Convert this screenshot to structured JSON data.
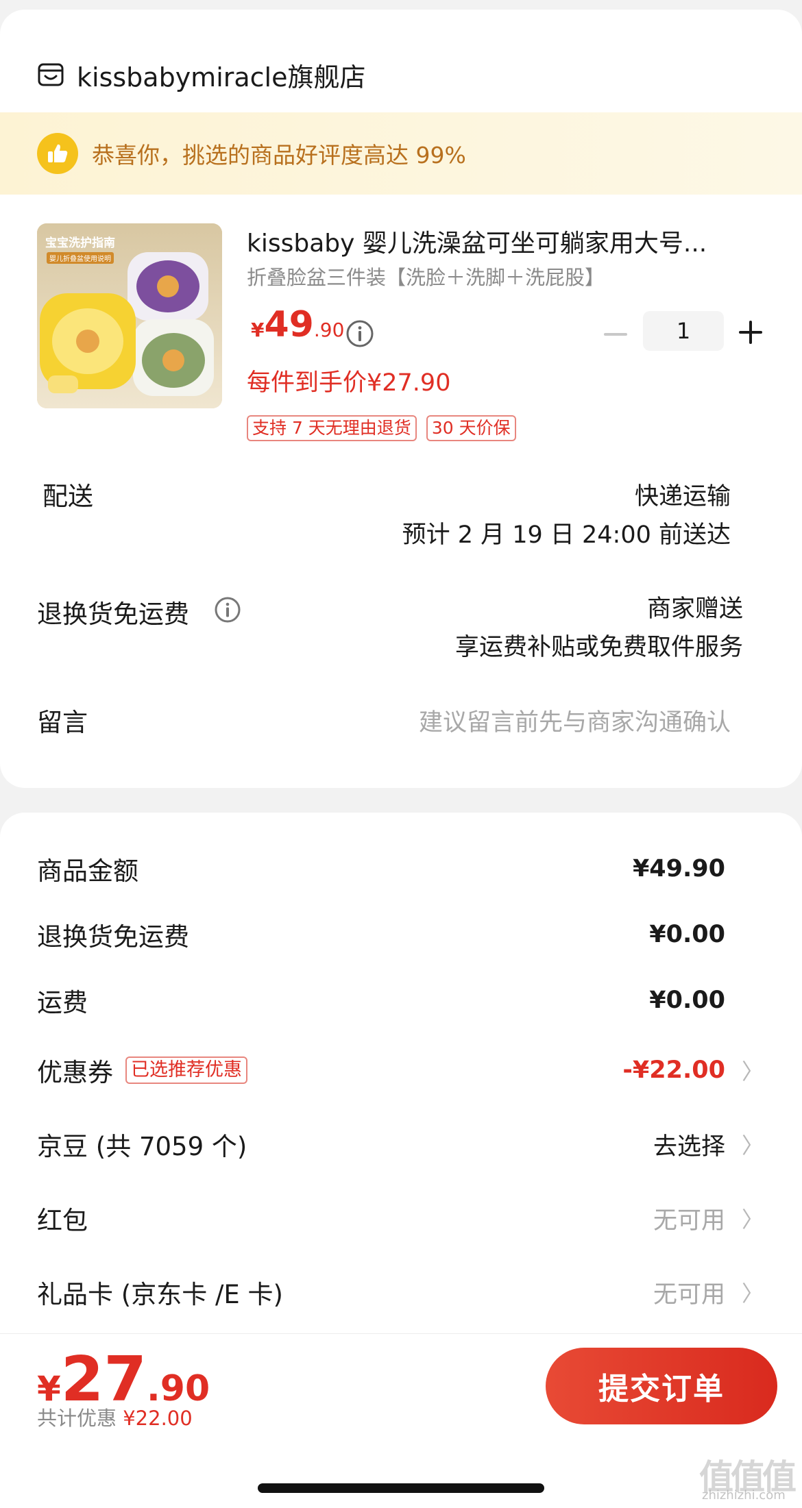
{
  "shop": {
    "name": "kissbabymiracle旗舰店",
    "icon": "store-icon"
  },
  "banner": {
    "text": "恭喜你，挑选的商品好评度高达 99%",
    "icon": "thumbs-up-icon"
  },
  "product": {
    "title": "kissbaby 婴儿洗澡盆可坐可躺家用大号折叠脸盆三件装【洗脸＋洗脚＋洗屁股】",
    "title_display": "kissbaby 婴儿洗澡盆可坐可躺家用大号...",
    "spec": "折叠脸盆三件装【洗脸＋洗脚＋洗屁股】",
    "price_yen": "¥",
    "price_int": "49",
    "price_dec": ".90",
    "quantity": "1",
    "unit_price": "每件到手价¥27.90",
    "tags": [
      "支持 7 天无理由退货",
      "30 天价保"
    ],
    "image_caption": "宝宝洗护指南",
    "image_subcaption": "婴儿折叠盆使用说明"
  },
  "delivery": {
    "label": "配送",
    "method": "快递运输",
    "eta": "预计 2 月 19 日 24:00 前送达"
  },
  "return_shipping": {
    "label": "退换货免运费",
    "value1": "商家赠送",
    "value2": "享运费补贴或免费取件服务"
  },
  "message": {
    "label": "留言",
    "placeholder": "建议留言前先与商家沟通确认"
  },
  "summary": {
    "goods_amount": {
      "label": "商品金额",
      "value": "¥49.90"
    },
    "return_fee": {
      "label": "退换货免运费",
      "value": "¥0.00"
    },
    "shipping": {
      "label": "运费",
      "value": "¥0.00"
    },
    "coupon": {
      "label": "优惠券",
      "tag": "已选推荐优惠",
      "value": "-¥22.00"
    },
    "jingdou": {
      "label": "京豆 (共 7059 个)",
      "value": "去选择"
    },
    "redpacket": {
      "label": "红包",
      "value": "无可用"
    },
    "giftcard": {
      "label": "礼品卡 (京东卡 /E 卡)",
      "value": "无可用"
    }
  },
  "footer": {
    "total_yen": "¥",
    "total_int": "27",
    "total_dec": ".90",
    "discount_label": "共计优惠",
    "discount_amount": "¥22.00",
    "submit_label": "提交订单"
  },
  "watermark": {
    "text": "值值值",
    "sub": "zhizhizhi.com"
  },
  "colors": {
    "accent": "#e02e24",
    "banner_text": "#b8701e",
    "banner_bg": "#fdf3d4"
  }
}
